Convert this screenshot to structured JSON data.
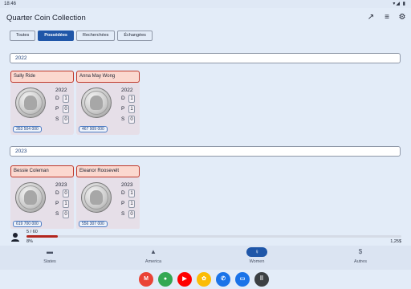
{
  "status": {
    "time": "18:46",
    "sys": "▾◢ ▮"
  },
  "appbar": {
    "title": "Quarter Coin Collection",
    "icons": [
      "trending-up-icon",
      "sort-icon",
      "settings-icon"
    ]
  },
  "filters": [
    "Toutes",
    "Possédées",
    "Recherchées",
    "Échangées"
  ],
  "filters_active": "Possédées",
  "sections": [
    {
      "year": "2022",
      "cards": [
        {
          "name": "Sally Ride",
          "year": "2022",
          "d": "1",
          "p": "0",
          "s": "0",
          "price": "353 504 000"
        },
        {
          "name": "Anna May Wong",
          "year": "2022",
          "d": "1",
          "p": "1",
          "s": "0",
          "price": "467 909 000"
        }
      ]
    },
    {
      "year": "2023",
      "cards": [
        {
          "name": "Bessie Coleman",
          "year": "2023",
          "d": "0",
          "p": "1",
          "s": "0",
          "price": "619 700 000"
        },
        {
          "name": "Eleanor Roosevelt",
          "year": "2023",
          "d": "1",
          "p": "1",
          "s": "0",
          "price": "556 307 000"
        }
      ]
    }
  ],
  "labels": {
    "d": "D",
    "p": "P",
    "s": "S"
  },
  "progress": {
    "count": "5 / 60",
    "percent_text": "8%",
    "total": "1,25$",
    "fraction": 0.083
  },
  "nav": [
    {
      "label": "States",
      "icon": "map-icon",
      "glyph": "▬"
    },
    {
      "label": "America",
      "icon": "landscape-icon",
      "glyph": "▲"
    },
    {
      "label": "Women",
      "icon": "woman-icon",
      "glyph": "♀"
    },
    {
      "label": "Autres",
      "icon": "dollar-icon",
      "glyph": "$"
    }
  ],
  "nav_active": "Women",
  "dock": [
    {
      "icon": "gmail-icon",
      "glyph": "M",
      "color": "#ea4335"
    },
    {
      "icon": "chrome-icon",
      "glyph": "●",
      "color": "#34a853"
    },
    {
      "icon": "youtube-icon",
      "glyph": "▶",
      "color": "#ff0000"
    },
    {
      "icon": "photos-icon",
      "glyph": "✿",
      "color": "#fbbc05"
    },
    {
      "icon": "phone-icon",
      "glyph": "✆",
      "color": "#1a73e8"
    },
    {
      "icon": "messages-icon",
      "glyph": "▭",
      "color": "#1a73e8"
    },
    {
      "icon": "app-drawer-icon",
      "glyph": "⠿",
      "color": "#3c4043"
    }
  ]
}
